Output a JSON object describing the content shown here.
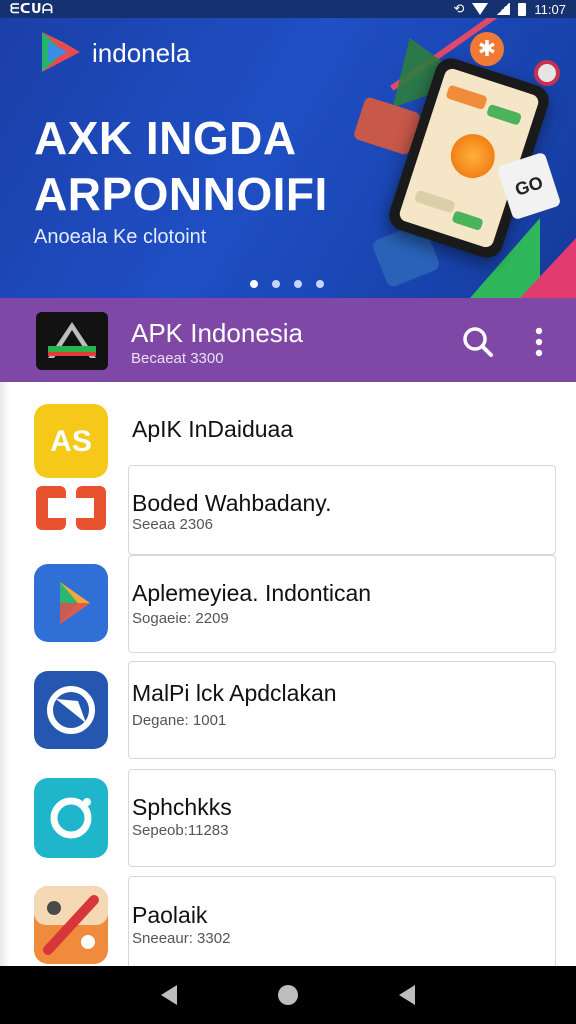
{
  "status_bar": {
    "left_text": "ᗴᑕᑌᗩ",
    "time": "11:07"
  },
  "banner": {
    "brand": "indonela",
    "title_line1": "AXK INGDA",
    "title_line2": "ARPONNOIFI",
    "subtitle": "Anoeala Ke clotoint",
    "game_badge": "GO",
    "carousel": {
      "page_count": 4,
      "active_index": 0
    }
  },
  "app_bar": {
    "title": "APK Indonesia",
    "subtitle": "Becaeat 3300",
    "icons": {
      "search": "search-icon",
      "more": "more-vert-icon"
    },
    "color": "#7f48a7"
  },
  "apps": [
    {
      "title": "ApIK InDaiduaa",
      "subtitle": "",
      "icon": "yellow-app-icon",
      "color": "#f5c81a"
    },
    {
      "title": "Boded Wahbadany.",
      "subtitle": "Seeaa 2306",
      "icon": "orange-app-icon",
      "color": "#e8522f"
    },
    {
      "title": "Aplemeyiea. Indontican",
      "subtitle": "Sogaeie: 2209",
      "icon": "play-app-icon",
      "color": "#2f6fd6"
    },
    {
      "title": "MalPi lck Apdclakan",
      "subtitle": "Degane: 1001",
      "icon": "chat-app-icon",
      "color": "#2657b0"
    },
    {
      "title": "Sphchkks",
      "subtitle": "Sepeob:11283",
      "icon": "ring-app-icon",
      "color": "#1fb6cc"
    },
    {
      "title": "Paolaik",
      "subtitle": "Sneeaur: 3302",
      "icon": "percent-app-icon",
      "color": "#f08a3c"
    }
  ],
  "nav_bar": {
    "back": "back-icon",
    "home": "home-icon",
    "recents": "recents-icon"
  }
}
